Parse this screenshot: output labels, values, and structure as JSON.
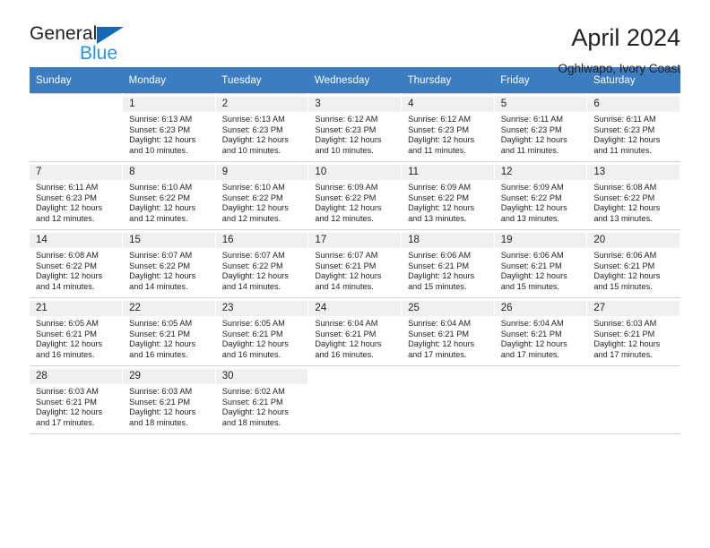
{
  "brand": {
    "name_part1": "General",
    "name_part2": "Blue",
    "logo_icon": "triangle-logo-icon",
    "accent_color": "#2e93dd",
    "header_color": "#3b7dc0"
  },
  "header": {
    "title": "April 2024",
    "subtitle": "Oghlwapo, Ivory Coast"
  },
  "weekday_headers": [
    "Sunday",
    "Monday",
    "Tuesday",
    "Wednesday",
    "Thursday",
    "Friday",
    "Saturday"
  ],
  "weeks": [
    [
      {
        "day": "",
        "sunrise": "",
        "sunset": "",
        "daylight1": "",
        "daylight2": ""
      },
      {
        "day": "1",
        "sunrise": "Sunrise: 6:13 AM",
        "sunset": "Sunset: 6:23 PM",
        "daylight1": "Daylight: 12 hours",
        "daylight2": "and 10 minutes."
      },
      {
        "day": "2",
        "sunrise": "Sunrise: 6:13 AM",
        "sunset": "Sunset: 6:23 PM",
        "daylight1": "Daylight: 12 hours",
        "daylight2": "and 10 minutes."
      },
      {
        "day": "3",
        "sunrise": "Sunrise: 6:12 AM",
        "sunset": "Sunset: 6:23 PM",
        "daylight1": "Daylight: 12 hours",
        "daylight2": "and 10 minutes."
      },
      {
        "day": "4",
        "sunrise": "Sunrise: 6:12 AM",
        "sunset": "Sunset: 6:23 PM",
        "daylight1": "Daylight: 12 hours",
        "daylight2": "and 11 minutes."
      },
      {
        "day": "5",
        "sunrise": "Sunrise: 6:11 AM",
        "sunset": "Sunset: 6:23 PM",
        "daylight1": "Daylight: 12 hours",
        "daylight2": "and 11 minutes."
      },
      {
        "day": "6",
        "sunrise": "Sunrise: 6:11 AM",
        "sunset": "Sunset: 6:23 PM",
        "daylight1": "Daylight: 12 hours",
        "daylight2": "and 11 minutes."
      }
    ],
    [
      {
        "day": "7",
        "sunrise": "Sunrise: 6:11 AM",
        "sunset": "Sunset: 6:23 PM",
        "daylight1": "Daylight: 12 hours",
        "daylight2": "and 12 minutes."
      },
      {
        "day": "8",
        "sunrise": "Sunrise: 6:10 AM",
        "sunset": "Sunset: 6:22 PM",
        "daylight1": "Daylight: 12 hours",
        "daylight2": "and 12 minutes."
      },
      {
        "day": "9",
        "sunrise": "Sunrise: 6:10 AM",
        "sunset": "Sunset: 6:22 PM",
        "daylight1": "Daylight: 12 hours",
        "daylight2": "and 12 minutes."
      },
      {
        "day": "10",
        "sunrise": "Sunrise: 6:09 AM",
        "sunset": "Sunset: 6:22 PM",
        "daylight1": "Daylight: 12 hours",
        "daylight2": "and 12 minutes."
      },
      {
        "day": "11",
        "sunrise": "Sunrise: 6:09 AM",
        "sunset": "Sunset: 6:22 PM",
        "daylight1": "Daylight: 12 hours",
        "daylight2": "and 13 minutes."
      },
      {
        "day": "12",
        "sunrise": "Sunrise: 6:09 AM",
        "sunset": "Sunset: 6:22 PM",
        "daylight1": "Daylight: 12 hours",
        "daylight2": "and 13 minutes."
      },
      {
        "day": "13",
        "sunrise": "Sunrise: 6:08 AM",
        "sunset": "Sunset: 6:22 PM",
        "daylight1": "Daylight: 12 hours",
        "daylight2": "and 13 minutes."
      }
    ],
    [
      {
        "day": "14",
        "sunrise": "Sunrise: 6:08 AM",
        "sunset": "Sunset: 6:22 PM",
        "daylight1": "Daylight: 12 hours",
        "daylight2": "and 14 minutes."
      },
      {
        "day": "15",
        "sunrise": "Sunrise: 6:07 AM",
        "sunset": "Sunset: 6:22 PM",
        "daylight1": "Daylight: 12 hours",
        "daylight2": "and 14 minutes."
      },
      {
        "day": "16",
        "sunrise": "Sunrise: 6:07 AM",
        "sunset": "Sunset: 6:22 PM",
        "daylight1": "Daylight: 12 hours",
        "daylight2": "and 14 minutes."
      },
      {
        "day": "17",
        "sunrise": "Sunrise: 6:07 AM",
        "sunset": "Sunset: 6:21 PM",
        "daylight1": "Daylight: 12 hours",
        "daylight2": "and 14 minutes."
      },
      {
        "day": "18",
        "sunrise": "Sunrise: 6:06 AM",
        "sunset": "Sunset: 6:21 PM",
        "daylight1": "Daylight: 12 hours",
        "daylight2": "and 15 minutes."
      },
      {
        "day": "19",
        "sunrise": "Sunrise: 6:06 AM",
        "sunset": "Sunset: 6:21 PM",
        "daylight1": "Daylight: 12 hours",
        "daylight2": "and 15 minutes."
      },
      {
        "day": "20",
        "sunrise": "Sunrise: 6:06 AM",
        "sunset": "Sunset: 6:21 PM",
        "daylight1": "Daylight: 12 hours",
        "daylight2": "and 15 minutes."
      }
    ],
    [
      {
        "day": "21",
        "sunrise": "Sunrise: 6:05 AM",
        "sunset": "Sunset: 6:21 PM",
        "daylight1": "Daylight: 12 hours",
        "daylight2": "and 16 minutes."
      },
      {
        "day": "22",
        "sunrise": "Sunrise: 6:05 AM",
        "sunset": "Sunset: 6:21 PM",
        "daylight1": "Daylight: 12 hours",
        "daylight2": "and 16 minutes."
      },
      {
        "day": "23",
        "sunrise": "Sunrise: 6:05 AM",
        "sunset": "Sunset: 6:21 PM",
        "daylight1": "Daylight: 12 hours",
        "daylight2": "and 16 minutes."
      },
      {
        "day": "24",
        "sunrise": "Sunrise: 6:04 AM",
        "sunset": "Sunset: 6:21 PM",
        "daylight1": "Daylight: 12 hours",
        "daylight2": "and 16 minutes."
      },
      {
        "day": "25",
        "sunrise": "Sunrise: 6:04 AM",
        "sunset": "Sunset: 6:21 PM",
        "daylight1": "Daylight: 12 hours",
        "daylight2": "and 17 minutes."
      },
      {
        "day": "26",
        "sunrise": "Sunrise: 6:04 AM",
        "sunset": "Sunset: 6:21 PM",
        "daylight1": "Daylight: 12 hours",
        "daylight2": "and 17 minutes."
      },
      {
        "day": "27",
        "sunrise": "Sunrise: 6:03 AM",
        "sunset": "Sunset: 6:21 PM",
        "daylight1": "Daylight: 12 hours",
        "daylight2": "and 17 minutes."
      }
    ],
    [
      {
        "day": "28",
        "sunrise": "Sunrise: 6:03 AM",
        "sunset": "Sunset: 6:21 PM",
        "daylight1": "Daylight: 12 hours",
        "daylight2": "and 17 minutes."
      },
      {
        "day": "29",
        "sunrise": "Sunrise: 6:03 AM",
        "sunset": "Sunset: 6:21 PM",
        "daylight1": "Daylight: 12 hours",
        "daylight2": "and 18 minutes."
      },
      {
        "day": "30",
        "sunrise": "Sunrise: 6:02 AM",
        "sunset": "Sunset: 6:21 PM",
        "daylight1": "Daylight: 12 hours",
        "daylight2": "and 18 minutes."
      },
      {
        "day": "",
        "sunrise": "",
        "sunset": "",
        "daylight1": "",
        "daylight2": ""
      },
      {
        "day": "",
        "sunrise": "",
        "sunset": "",
        "daylight1": "",
        "daylight2": ""
      },
      {
        "day": "",
        "sunrise": "",
        "sunset": "",
        "daylight1": "",
        "daylight2": ""
      },
      {
        "day": "",
        "sunrise": "",
        "sunset": "",
        "daylight1": "",
        "daylight2": ""
      }
    ]
  ]
}
